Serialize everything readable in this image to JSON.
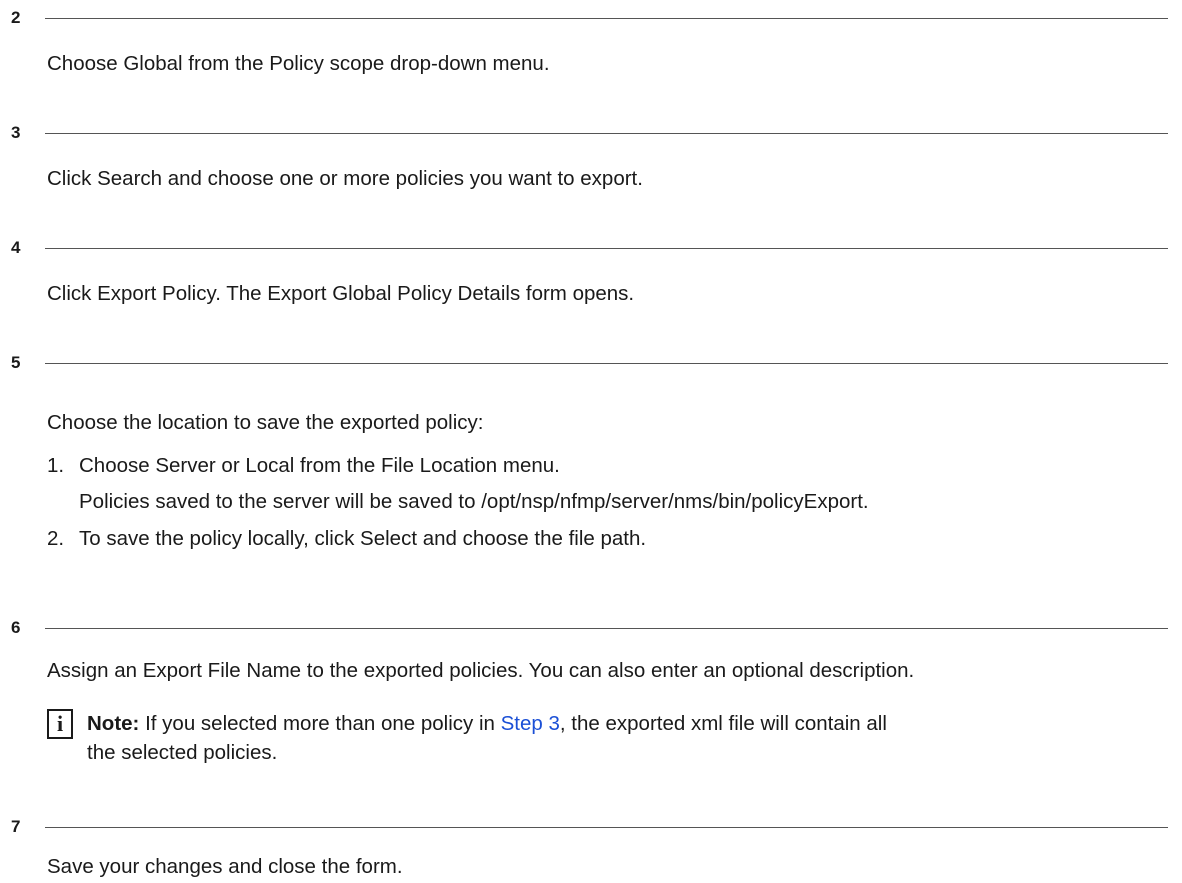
{
  "steps": [
    {
      "number": "2",
      "text": "Choose Global from the Policy scope drop-down menu."
    },
    {
      "number": "3",
      "text": "Click Search and choose one or more policies you want to export."
    },
    {
      "number": "4",
      "text": "Click Export Policy. The Export Global Policy Details form opens."
    },
    {
      "number": "5",
      "text": "Choose the location to save the exported policy:",
      "substeps": [
        {
          "label": "1.",
          "text": "Choose Server or Local from the File Location menu.",
          "detail": "Policies saved to the server will be saved to /opt/nsp/nfmp/server/nms/bin/policyExport."
        },
        {
          "label": "2.",
          "text": "To save the policy locally, click Select and choose the file path."
        }
      ]
    },
    {
      "number": "6",
      "text": "Assign an Export File Name to the exported policies. You can also enter an optional description.",
      "note": {
        "icon": "info-icon",
        "icon_glyph": "i",
        "label": "Note:",
        "text_before": " If you selected more than one policy in ",
        "link": "Step 3",
        "text_after": ", the exported xml file will contain all",
        "line2": "the selected policies."
      }
    },
    {
      "number": "7",
      "text": "Save your changes and close the form."
    }
  ]
}
